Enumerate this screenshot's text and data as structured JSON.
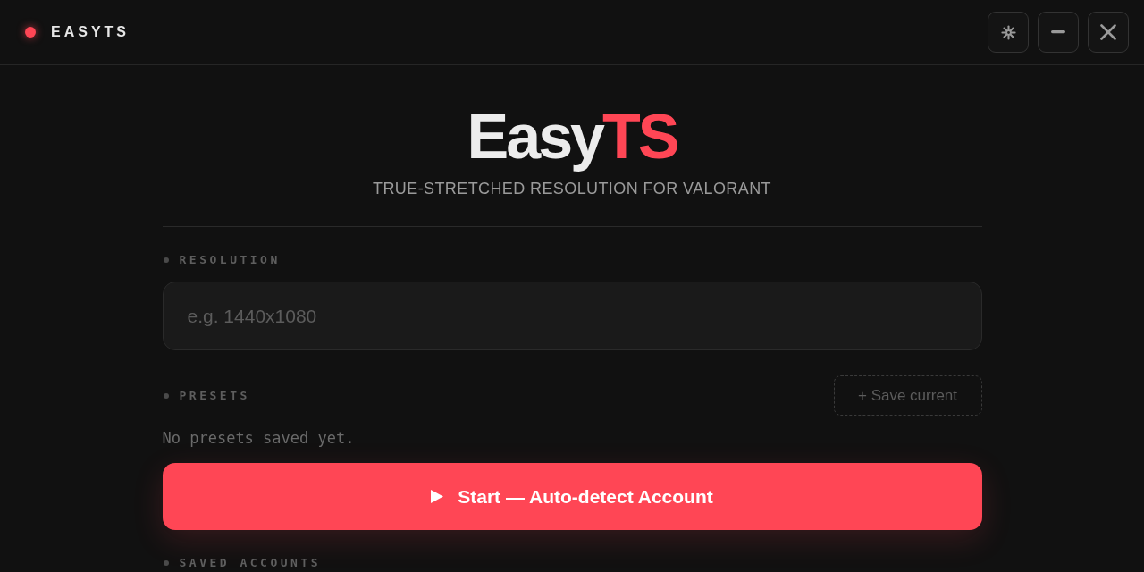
{
  "titlebar": {
    "title": "EASYTS",
    "buttons": [
      {
        "kind": "settings"
      },
      {
        "kind": "minimize"
      },
      {
        "kind": "close"
      }
    ]
  },
  "header": {
    "logo": {
      "text": "Easy",
      "accent": "TS"
    },
    "subtitle": "TRUE-STRETCHED RESOLUTION FOR VALORANT"
  },
  "resolution": {
    "label": "RESOLUTION",
    "placeholder": "e.g. 1440x1080"
  },
  "presets": {
    "label": "PRESETS",
    "save_button": "+ Save current",
    "empty_message": "No presets saved yet."
  },
  "start_button": {
    "label": "Start — Auto-detect Account"
  },
  "saved_accounts": {
    "label": "SAVED ACCOUNTS"
  }
}
